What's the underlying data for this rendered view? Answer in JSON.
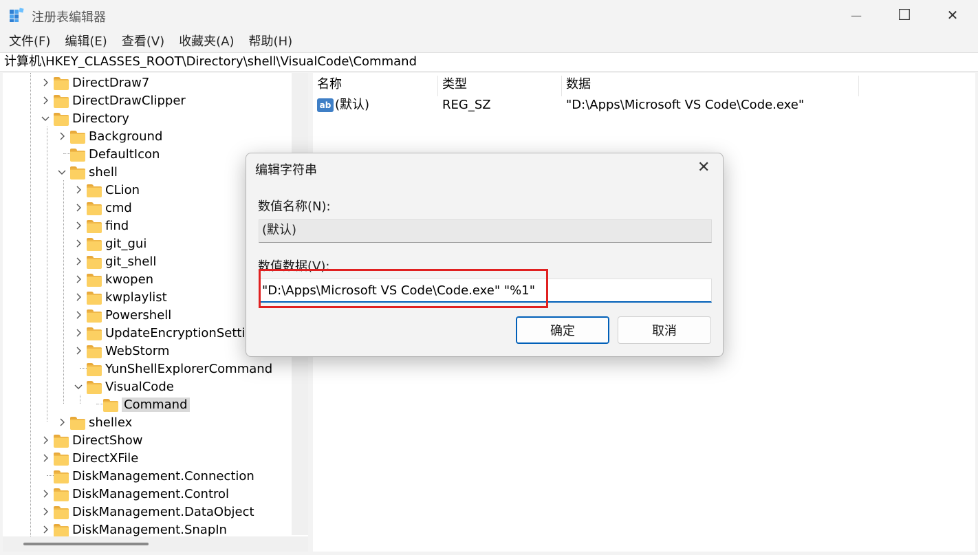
{
  "window": {
    "title": "注册表编辑器",
    "minimize_glyph": "—",
    "maximize_glyph": "☐",
    "close_glyph": "✕"
  },
  "menu": [
    "文件(F)",
    "编辑(E)",
    "查看(V)",
    "收藏夹(A)",
    "帮助(H)"
  ],
  "address": "计算机\\HKEY_CLASSES_ROOT\\Directory\\shell\\VisualCode\\Command",
  "tree": [
    {
      "label": "DirectDraw7",
      "expander": "collapsed"
    },
    {
      "label": "DirectDrawClipper",
      "expander": "collapsed"
    },
    {
      "label": "Directory",
      "expander": "expanded"
    },
    {
      "label": "Background",
      "expander": "collapsed"
    },
    {
      "label": "DefaultIcon",
      "expander": "none"
    },
    {
      "label": "shell",
      "expander": "expanded"
    },
    {
      "label": "CLion",
      "expander": "collapsed"
    },
    {
      "label": "cmd",
      "expander": "collapsed"
    },
    {
      "label": "find",
      "expander": "collapsed"
    },
    {
      "label": "git_gui",
      "expander": "collapsed"
    },
    {
      "label": "git_shell",
      "expander": "collapsed"
    },
    {
      "label": "kwopen",
      "expander": "collapsed"
    },
    {
      "label": "kwplaylist",
      "expander": "collapsed"
    },
    {
      "label": "Powershell",
      "expander": "collapsed"
    },
    {
      "label": "UpdateEncryptionSettin",
      "expander": "collapsed"
    },
    {
      "label": "WebStorm",
      "expander": "collapsed"
    },
    {
      "label": "YunShellExplorerCommand",
      "expander": "none"
    },
    {
      "label": "VisualCode",
      "expander": "expanded"
    },
    {
      "label": "Command",
      "expander": "none",
      "selected": true
    },
    {
      "label": "shellex",
      "expander": "collapsed"
    },
    {
      "label": "DirectShow",
      "expander": "collapsed"
    },
    {
      "label": "DirectXFile",
      "expander": "collapsed"
    },
    {
      "label": "DiskManagement.Connection",
      "expander": "none"
    },
    {
      "label": "DiskManagement.Control",
      "expander": "collapsed"
    },
    {
      "label": "DiskManagement.DataObject",
      "expander": "collapsed"
    },
    {
      "label": "DiskManagement.SnapIn",
      "expander": "collapsed"
    }
  ],
  "list": {
    "columns": [
      "名称",
      "类型",
      "数据"
    ],
    "rows": [
      {
        "icon": "ab",
        "name": "(默认)",
        "type": "REG_SZ",
        "data": "\"D:\\Apps\\Microsoft VS Code\\Code.exe\""
      }
    ]
  },
  "dialog": {
    "title": "编辑字符串",
    "close_glyph": "✕",
    "name_label": "数值名称(N):",
    "name_value": "(默认)",
    "data_label": "数值数据(V):",
    "data_value": "\"D:\\Apps\\Microsoft VS Code\\Code.exe\" \"%1\"",
    "ok_label": "确定",
    "cancel_label": "取消"
  },
  "colors": {
    "accent": "#005fb8",
    "highlight_box": "#e02020",
    "folder": "#fcd062"
  }
}
